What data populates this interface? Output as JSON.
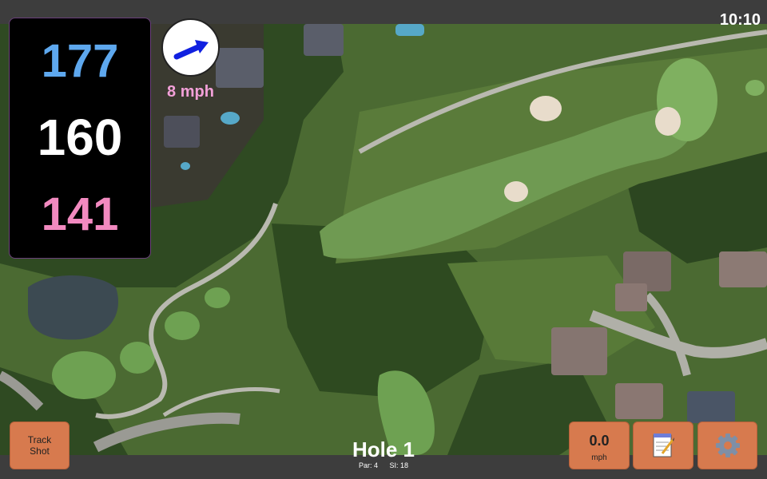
{
  "status": {
    "time": "10:10"
  },
  "yardages": {
    "back": "177",
    "middle": "160",
    "front": "141",
    "colors": {
      "back": "#5ea8ee",
      "middle": "#ffffff",
      "front": "#f28ac0"
    }
  },
  "wind": {
    "speed": "8 mph",
    "icon": "wind-arrow-icon",
    "color": "#f2a0d8"
  },
  "buttons": {
    "track_shot": [
      "Track",
      "Shot"
    ],
    "speed": {
      "value": "0.0",
      "unit": "mph"
    },
    "notes_icon": "notepad-icon",
    "settings_icon": "gear-icon",
    "accent": "#d77a4e"
  },
  "hole": {
    "title": "Hole 1",
    "par": "Par: 4",
    "si": "SI: 18"
  }
}
